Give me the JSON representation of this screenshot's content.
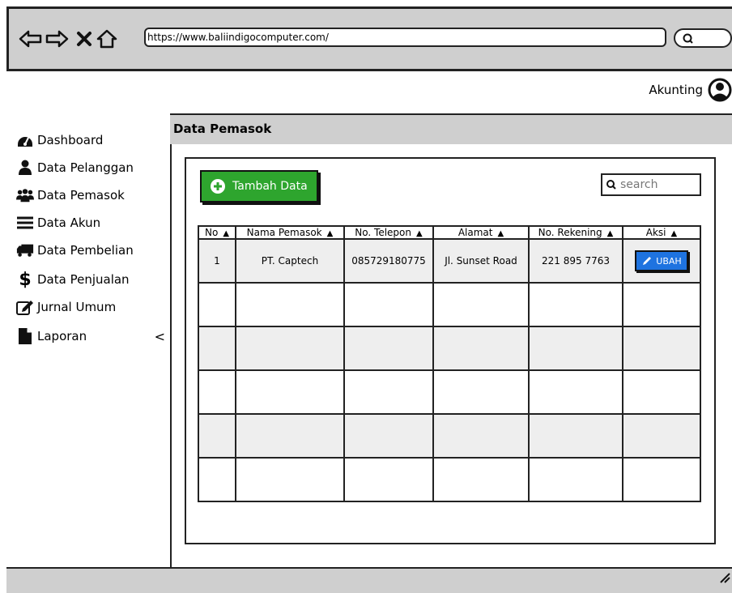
{
  "browser": {
    "url": "https://www.baliindigocomputer.com/"
  },
  "header": {
    "user_label": "Akunting"
  },
  "sidebar": {
    "items": [
      {
        "label": "Dashboard",
        "icon": "dashboard-icon"
      },
      {
        "label": "Data Pelanggan",
        "icon": "user-icon"
      },
      {
        "label": "Data Pemasok",
        "icon": "users-icon"
      },
      {
        "label": "Data Akun",
        "icon": "list-icon"
      },
      {
        "label": "Data Pembelian",
        "icon": "truck-icon"
      },
      {
        "label": "Data Penjualan",
        "icon": "dollar-icon"
      },
      {
        "label": "Jurnal Umum",
        "icon": "edit-icon"
      },
      {
        "label": "Laporan",
        "icon": "file-icon"
      }
    ],
    "laporan_chevron": "<"
  },
  "page": {
    "title": "Data Pemasok",
    "add_button": "Tambah Data",
    "search_placeholder": "search"
  },
  "table": {
    "headers": [
      "No",
      "Nama Pemasok",
      "No. Telepon",
      "Alamat",
      "No. Rekening",
      "Aksi"
    ],
    "rows": [
      {
        "no": "1",
        "nama": "PT. Captech",
        "telepon": "085729180775",
        "alamat": "Jl. Sunset Road",
        "rekening": "221 895 7763",
        "aksi": "UBAH"
      }
    ]
  },
  "colors": {
    "add_button": "#2ea52e",
    "edit_button": "#1e73e0",
    "chrome_gray": "#cfcfcf"
  }
}
